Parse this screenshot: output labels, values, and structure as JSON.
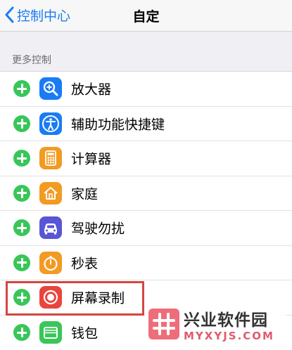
{
  "navbar": {
    "back_label": "控制中心",
    "title": "自定"
  },
  "section": {
    "header": "更多控制"
  },
  "items": [
    {
      "label": "放大器",
      "icon": "magnifier-icon",
      "color": "#1a7cf5"
    },
    {
      "label": "辅助功能快捷键",
      "icon": "accessibility-icon",
      "color": "#1a7cf5"
    },
    {
      "label": "计算器",
      "icon": "calculator-icon",
      "color": "#f29a22"
    },
    {
      "label": "家庭",
      "icon": "home-icon",
      "color": "#f29a22"
    },
    {
      "label": "驾驶勿扰",
      "icon": "car-icon",
      "color": "#5856d6"
    },
    {
      "label": "秒表",
      "icon": "stopwatch-icon",
      "color": "#f29a22"
    },
    {
      "label": "屏幕录制",
      "icon": "screen-record-icon",
      "color": "#e8453c"
    },
    {
      "label": "钱包",
      "icon": "wallet-icon",
      "color": "#39c659"
    }
  ],
  "colors": {
    "add_button": "#39c659",
    "highlight_box": "#d5453e",
    "link_blue": "#1a7cf5"
  },
  "watermark": {
    "title": "兴业软件园",
    "url": "MYXYJS.COM"
  }
}
